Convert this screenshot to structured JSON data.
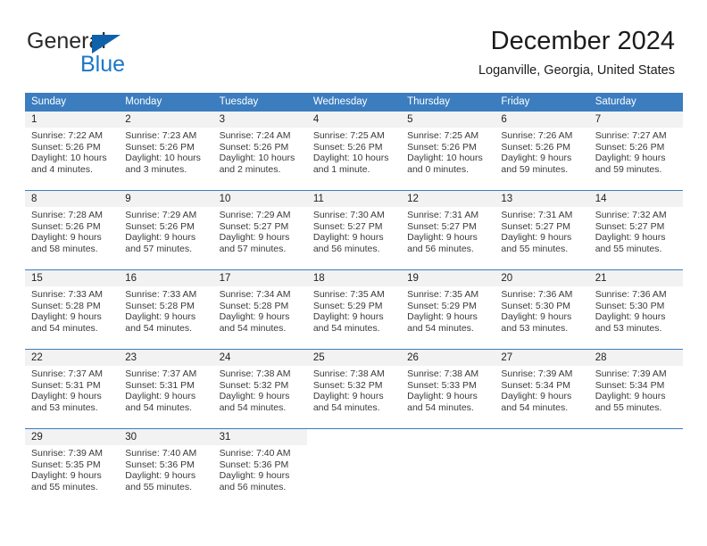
{
  "brand": {
    "name_part1": "General",
    "name_part2": "Blue",
    "triangle_color": "#1061ab",
    "blue_color": "#1b77c9"
  },
  "header": {
    "month_title": "December 2024",
    "location": "Loganville, Georgia, United States"
  },
  "theme": {
    "header_blue": "#3b7dbf",
    "day_band_gray": "#f2f2f2",
    "text_color": "#3a3a3a"
  },
  "weekdays": [
    "Sunday",
    "Monday",
    "Tuesday",
    "Wednesday",
    "Thursday",
    "Friday",
    "Saturday"
  ],
  "weeks": [
    [
      {
        "day": "1",
        "sunrise": "Sunrise: 7:22 AM",
        "sunset": "Sunset: 5:26 PM",
        "daylight": "Daylight: 10 hours and 4 minutes."
      },
      {
        "day": "2",
        "sunrise": "Sunrise: 7:23 AM",
        "sunset": "Sunset: 5:26 PM",
        "daylight": "Daylight: 10 hours and 3 minutes."
      },
      {
        "day": "3",
        "sunrise": "Sunrise: 7:24 AM",
        "sunset": "Sunset: 5:26 PM",
        "daylight": "Daylight: 10 hours and 2 minutes."
      },
      {
        "day": "4",
        "sunrise": "Sunrise: 7:25 AM",
        "sunset": "Sunset: 5:26 PM",
        "daylight": "Daylight: 10 hours and 1 minute."
      },
      {
        "day": "5",
        "sunrise": "Sunrise: 7:25 AM",
        "sunset": "Sunset: 5:26 PM",
        "daylight": "Daylight: 10 hours and 0 minutes."
      },
      {
        "day": "6",
        "sunrise": "Sunrise: 7:26 AM",
        "sunset": "Sunset: 5:26 PM",
        "daylight": "Daylight: 9 hours and 59 minutes."
      },
      {
        "day": "7",
        "sunrise": "Sunrise: 7:27 AM",
        "sunset": "Sunset: 5:26 PM",
        "daylight": "Daylight: 9 hours and 59 minutes."
      }
    ],
    [
      {
        "day": "8",
        "sunrise": "Sunrise: 7:28 AM",
        "sunset": "Sunset: 5:26 PM",
        "daylight": "Daylight: 9 hours and 58 minutes."
      },
      {
        "day": "9",
        "sunrise": "Sunrise: 7:29 AM",
        "sunset": "Sunset: 5:26 PM",
        "daylight": "Daylight: 9 hours and 57 minutes."
      },
      {
        "day": "10",
        "sunrise": "Sunrise: 7:29 AM",
        "sunset": "Sunset: 5:27 PM",
        "daylight": "Daylight: 9 hours and 57 minutes."
      },
      {
        "day": "11",
        "sunrise": "Sunrise: 7:30 AM",
        "sunset": "Sunset: 5:27 PM",
        "daylight": "Daylight: 9 hours and 56 minutes."
      },
      {
        "day": "12",
        "sunrise": "Sunrise: 7:31 AM",
        "sunset": "Sunset: 5:27 PM",
        "daylight": "Daylight: 9 hours and 56 minutes."
      },
      {
        "day": "13",
        "sunrise": "Sunrise: 7:31 AM",
        "sunset": "Sunset: 5:27 PM",
        "daylight": "Daylight: 9 hours and 55 minutes."
      },
      {
        "day": "14",
        "sunrise": "Sunrise: 7:32 AM",
        "sunset": "Sunset: 5:27 PM",
        "daylight": "Daylight: 9 hours and 55 minutes."
      }
    ],
    [
      {
        "day": "15",
        "sunrise": "Sunrise: 7:33 AM",
        "sunset": "Sunset: 5:28 PM",
        "daylight": "Daylight: 9 hours and 54 minutes."
      },
      {
        "day": "16",
        "sunrise": "Sunrise: 7:33 AM",
        "sunset": "Sunset: 5:28 PM",
        "daylight": "Daylight: 9 hours and 54 minutes."
      },
      {
        "day": "17",
        "sunrise": "Sunrise: 7:34 AM",
        "sunset": "Sunset: 5:28 PM",
        "daylight": "Daylight: 9 hours and 54 minutes."
      },
      {
        "day": "18",
        "sunrise": "Sunrise: 7:35 AM",
        "sunset": "Sunset: 5:29 PM",
        "daylight": "Daylight: 9 hours and 54 minutes."
      },
      {
        "day": "19",
        "sunrise": "Sunrise: 7:35 AM",
        "sunset": "Sunset: 5:29 PM",
        "daylight": "Daylight: 9 hours and 54 minutes."
      },
      {
        "day": "20",
        "sunrise": "Sunrise: 7:36 AM",
        "sunset": "Sunset: 5:30 PM",
        "daylight": "Daylight: 9 hours and 53 minutes."
      },
      {
        "day": "21",
        "sunrise": "Sunrise: 7:36 AM",
        "sunset": "Sunset: 5:30 PM",
        "daylight": "Daylight: 9 hours and 53 minutes."
      }
    ],
    [
      {
        "day": "22",
        "sunrise": "Sunrise: 7:37 AM",
        "sunset": "Sunset: 5:31 PM",
        "daylight": "Daylight: 9 hours and 53 minutes."
      },
      {
        "day": "23",
        "sunrise": "Sunrise: 7:37 AM",
        "sunset": "Sunset: 5:31 PM",
        "daylight": "Daylight: 9 hours and 54 minutes."
      },
      {
        "day": "24",
        "sunrise": "Sunrise: 7:38 AM",
        "sunset": "Sunset: 5:32 PM",
        "daylight": "Daylight: 9 hours and 54 minutes."
      },
      {
        "day": "25",
        "sunrise": "Sunrise: 7:38 AM",
        "sunset": "Sunset: 5:32 PM",
        "daylight": "Daylight: 9 hours and 54 minutes."
      },
      {
        "day": "26",
        "sunrise": "Sunrise: 7:38 AM",
        "sunset": "Sunset: 5:33 PM",
        "daylight": "Daylight: 9 hours and 54 minutes."
      },
      {
        "day": "27",
        "sunrise": "Sunrise: 7:39 AM",
        "sunset": "Sunset: 5:34 PM",
        "daylight": "Daylight: 9 hours and 54 minutes."
      },
      {
        "day": "28",
        "sunrise": "Sunrise: 7:39 AM",
        "sunset": "Sunset: 5:34 PM",
        "daylight": "Daylight: 9 hours and 55 minutes."
      }
    ],
    [
      {
        "day": "29",
        "sunrise": "Sunrise: 7:39 AM",
        "sunset": "Sunset: 5:35 PM",
        "daylight": "Daylight: 9 hours and 55 minutes."
      },
      {
        "day": "30",
        "sunrise": "Sunrise: 7:40 AM",
        "sunset": "Sunset: 5:36 PM",
        "daylight": "Daylight: 9 hours and 55 minutes."
      },
      {
        "day": "31",
        "sunrise": "Sunrise: 7:40 AM",
        "sunset": "Sunset: 5:36 PM",
        "daylight": "Daylight: 9 hours and 56 minutes."
      },
      {
        "day": "",
        "sunrise": "",
        "sunset": "",
        "daylight": ""
      },
      {
        "day": "",
        "sunrise": "",
        "sunset": "",
        "daylight": ""
      },
      {
        "day": "",
        "sunrise": "",
        "sunset": "",
        "daylight": ""
      },
      {
        "day": "",
        "sunrise": "",
        "sunset": "",
        "daylight": ""
      }
    ]
  ]
}
